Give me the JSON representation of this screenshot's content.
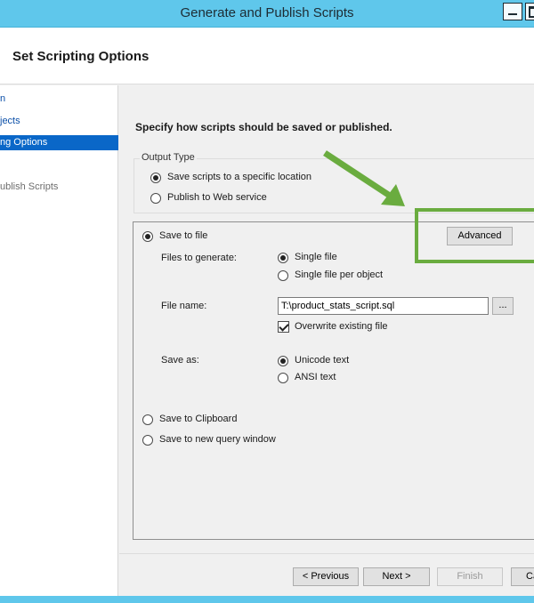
{
  "window": {
    "title": "Generate and Publish Scripts"
  },
  "header": {
    "title": "Set Scripting Options"
  },
  "sidebar": {
    "items": [
      {
        "label": "n",
        "state": "link"
      },
      {
        "label": "jects",
        "state": "link"
      },
      {
        "label": "ng Options",
        "state": "active"
      },
      {
        "label": "ublish Scripts",
        "state": "disabled"
      }
    ]
  },
  "main": {
    "instruction": "Specify how scripts should be saved or published.",
    "output_type": {
      "legend": "Output Type",
      "options": [
        {
          "label": "Save scripts to a specific location",
          "checked": true
        },
        {
          "label": "Publish to Web service",
          "checked": false
        }
      ]
    },
    "save_panel": {
      "save_to_file_label": "Save to file",
      "advanced_button": "Advanced",
      "files_to_generate_label": "Files to generate:",
      "files_options": [
        {
          "label": "Single file",
          "checked": true
        },
        {
          "label": "Single file per object",
          "checked": false
        }
      ],
      "file_name_label": "File name:",
      "file_name_value": "T:\\product_stats_script.sql",
      "browse_button": "...",
      "overwrite_label": "Overwrite existing file",
      "overwrite_checked": true,
      "save_as_label": "Save as:",
      "save_as_options": [
        {
          "label": "Unicode text",
          "checked": true
        },
        {
          "label": "ANSI text",
          "checked": false
        }
      ],
      "save_to_clipboard_label": "Save to Clipboard",
      "save_to_query_window_label": "Save to new query window"
    }
  },
  "footer": {
    "previous": "< Previous",
    "next": "Next >",
    "finish": "Finish",
    "cancel": "Ca"
  },
  "colors": {
    "titlebar": "#5fc7eb",
    "sidebar_active": "#0a67c8",
    "link": "#0b4fa8",
    "annotation_green": "#6aac3f"
  },
  "annotation": {
    "icon": "green-arrow-icon"
  }
}
